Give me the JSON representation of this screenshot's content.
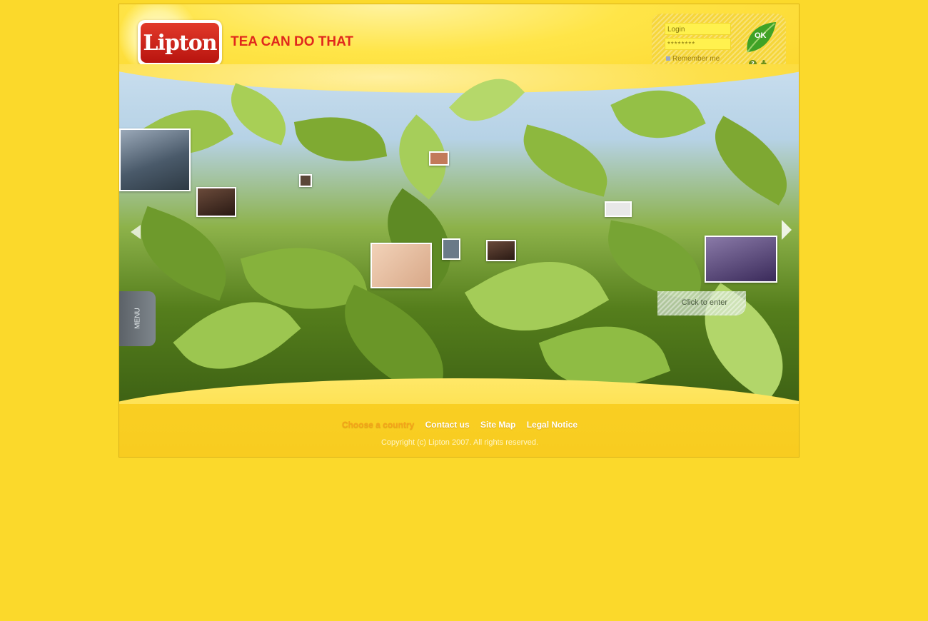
{
  "brand": {
    "logo_text": "Lipton",
    "tagline": "TEA CAN DO THAT"
  },
  "login": {
    "login_value": "Login",
    "password_value": "********",
    "remember_label": "Remember me",
    "ok_label": "OK",
    "help_icon": "question-icon",
    "users_icon": "users-icon"
  },
  "scene": {
    "enter_label": "Click to enter",
    "menu_label": "MENU"
  },
  "footer": {
    "links": [
      "Choose a country",
      "Contact us",
      "Site Map",
      "Legal Notice"
    ],
    "copyright": "Copyright (c) Lipton 2007. All rights reserved."
  },
  "colors": {
    "background": "#FBD92B",
    "brand_red": "#E0281C",
    "accent_orange": "#F3A21A",
    "leaf_green": "#6B8F1A"
  }
}
